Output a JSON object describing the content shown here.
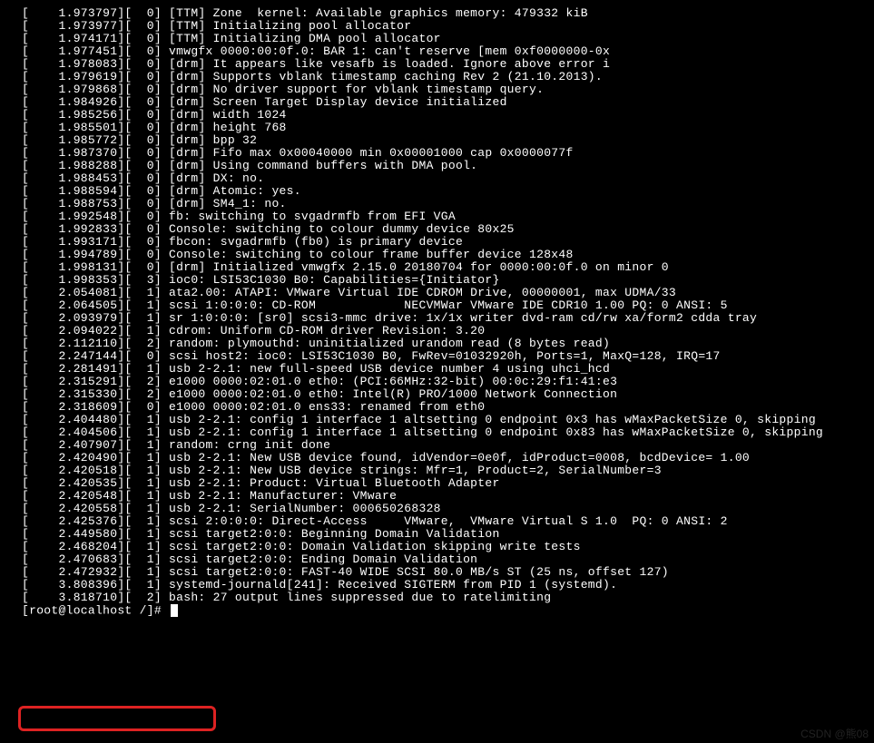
{
  "lines": [
    "[    1.973797][  0] [TTM] Zone  kernel: Available graphics memory: 479332 kiB",
    "[    1.973977][  0] [TTM] Initializing pool allocator",
    "[    1.974171][  0] [TTM] Initializing DMA pool allocator",
    "[    1.977451][  0] vmwgfx 0000:00:0f.0: BAR 1: can't reserve [mem 0xf0000000-0x",
    "[    1.978083][  0] [drm] It appears like vesafb is loaded. Ignore above error i",
    "[    1.979619][  0] [drm] Supports vblank timestamp caching Rev 2 (21.10.2013).",
    "[    1.979868][  0] [drm] No driver support for vblank timestamp query.",
    "[    1.984926][  0] [drm] Screen Target Display device initialized",
    "[    1.985256][  0] [drm] width 1024",
    "[    1.985501][  0] [drm] height 768",
    "[    1.985772][  0] [drm] bpp 32",
    "[    1.987370][  0] [drm] Fifo max 0x00040000 min 0x00001000 cap 0x0000077f",
    "[    1.988288][  0] [drm] Using command buffers with DMA pool.",
    "[    1.988453][  0] [drm] DX: no.",
    "[    1.988594][  0] [drm] Atomic: yes.",
    "[    1.988753][  0] [drm] SM4_1: no.",
    "[    1.992548][  0] fb: switching to svgadrmfb from EFI VGA",
    "[    1.992833][  0] Console: switching to colour dummy device 80x25",
    "[    1.993171][  0] fbcon: svgadrmfb (fb0) is primary device",
    "[    1.994789][  0] Console: switching to colour frame buffer device 128x48",
    "[    1.998131][  0] [drm] Initialized vmwgfx 2.15.0 20180704 for 0000:00:0f.0 on minor 0",
    "[    1.998353][  3] ioc0: LSI53C1030 B0: Capabilities={Initiator}",
    "[    2.054081][  1] ata2.00: ATAPI: VMware Virtual IDE CDROM Drive, 00000001, max UDMA/33",
    "[    2.064505][  1] scsi 1:0:0:0: CD-ROM            NECVMWar VMware IDE CDR10 1.00 PQ: 0 ANSI: 5",
    "[    2.093979][  1] sr 1:0:0:0: [sr0] scsi3-mmc drive: 1x/1x writer dvd-ram cd/rw xa/form2 cdda tray",
    "[    2.094022][  1] cdrom: Uniform CD-ROM driver Revision: 3.20",
    "[    2.112110][  2] random: plymouthd: uninitialized urandom read (8 bytes read)",
    "[    2.247144][  0] scsi host2: ioc0: LSI53C1030 B0, FwRev=01032920h, Ports=1, MaxQ=128, IRQ=17",
    "[    2.281491][  1] usb 2-2.1: new full-speed USB device number 4 using uhci_hcd",
    "[    2.315291][  2] e1000 0000:02:01.0 eth0: (PCI:66MHz:32-bit) 00:0c:29:f1:41:e3",
    "[    2.315330][  2] e1000 0000:02:01.0 eth0: Intel(R) PRO/1000 Network Connection",
    "[    2.318609][  0] e1000 0000:02:01.0 ens33: renamed from eth0",
    "[    2.404480][  1] usb 2-2.1: config 1 interface 1 altsetting 0 endpoint 0x3 has wMaxPacketSize 0, skipping",
    "[    2.404506][  1] usb 2-2.1: config 1 interface 1 altsetting 0 endpoint 0x83 has wMaxPacketSize 0, skipping",
    "[    2.407907][  1] random: crng init done",
    "[    2.420490][  1] usb 2-2.1: New USB device found, idVendor=0e0f, idProduct=0008, bcdDevice= 1.00",
    "[    2.420518][  1] usb 2-2.1: New USB device strings: Mfr=1, Product=2, SerialNumber=3",
    "[    2.420535][  1] usb 2-2.1: Product: Virtual Bluetooth Adapter",
    "[    2.420548][  1] usb 2-2.1: Manufacturer: VMware",
    "[    2.420558][  1] usb 2-2.1: SerialNumber: 000650268328",
    "[    2.425376][  1] scsi 2:0:0:0: Direct-Access     VMware,  VMware Virtual S 1.0  PQ: 0 ANSI: 2",
    "[    2.449580][  1] scsi target2:0:0: Beginning Domain Validation",
    "[    2.468204][  1] scsi target2:0:0: Domain Validation skipping write tests",
    "[    2.470683][  1] scsi target2:0:0: Ending Domain Validation",
    "[    2.472932][  1] scsi target2:0:0: FAST-40 WIDE SCSI 80.0 MB/s ST (25 ns, offset 127)",
    "[    3.808396][  1] systemd-journald[241]: Received SIGTERM from PID 1 (systemd).",
    "[    3.818710][  2] bash: 27 output lines suppressed due to ratelimiting"
  ],
  "prompt": "[root@localhost /]#",
  "watermark": "CSDN @熊08"
}
